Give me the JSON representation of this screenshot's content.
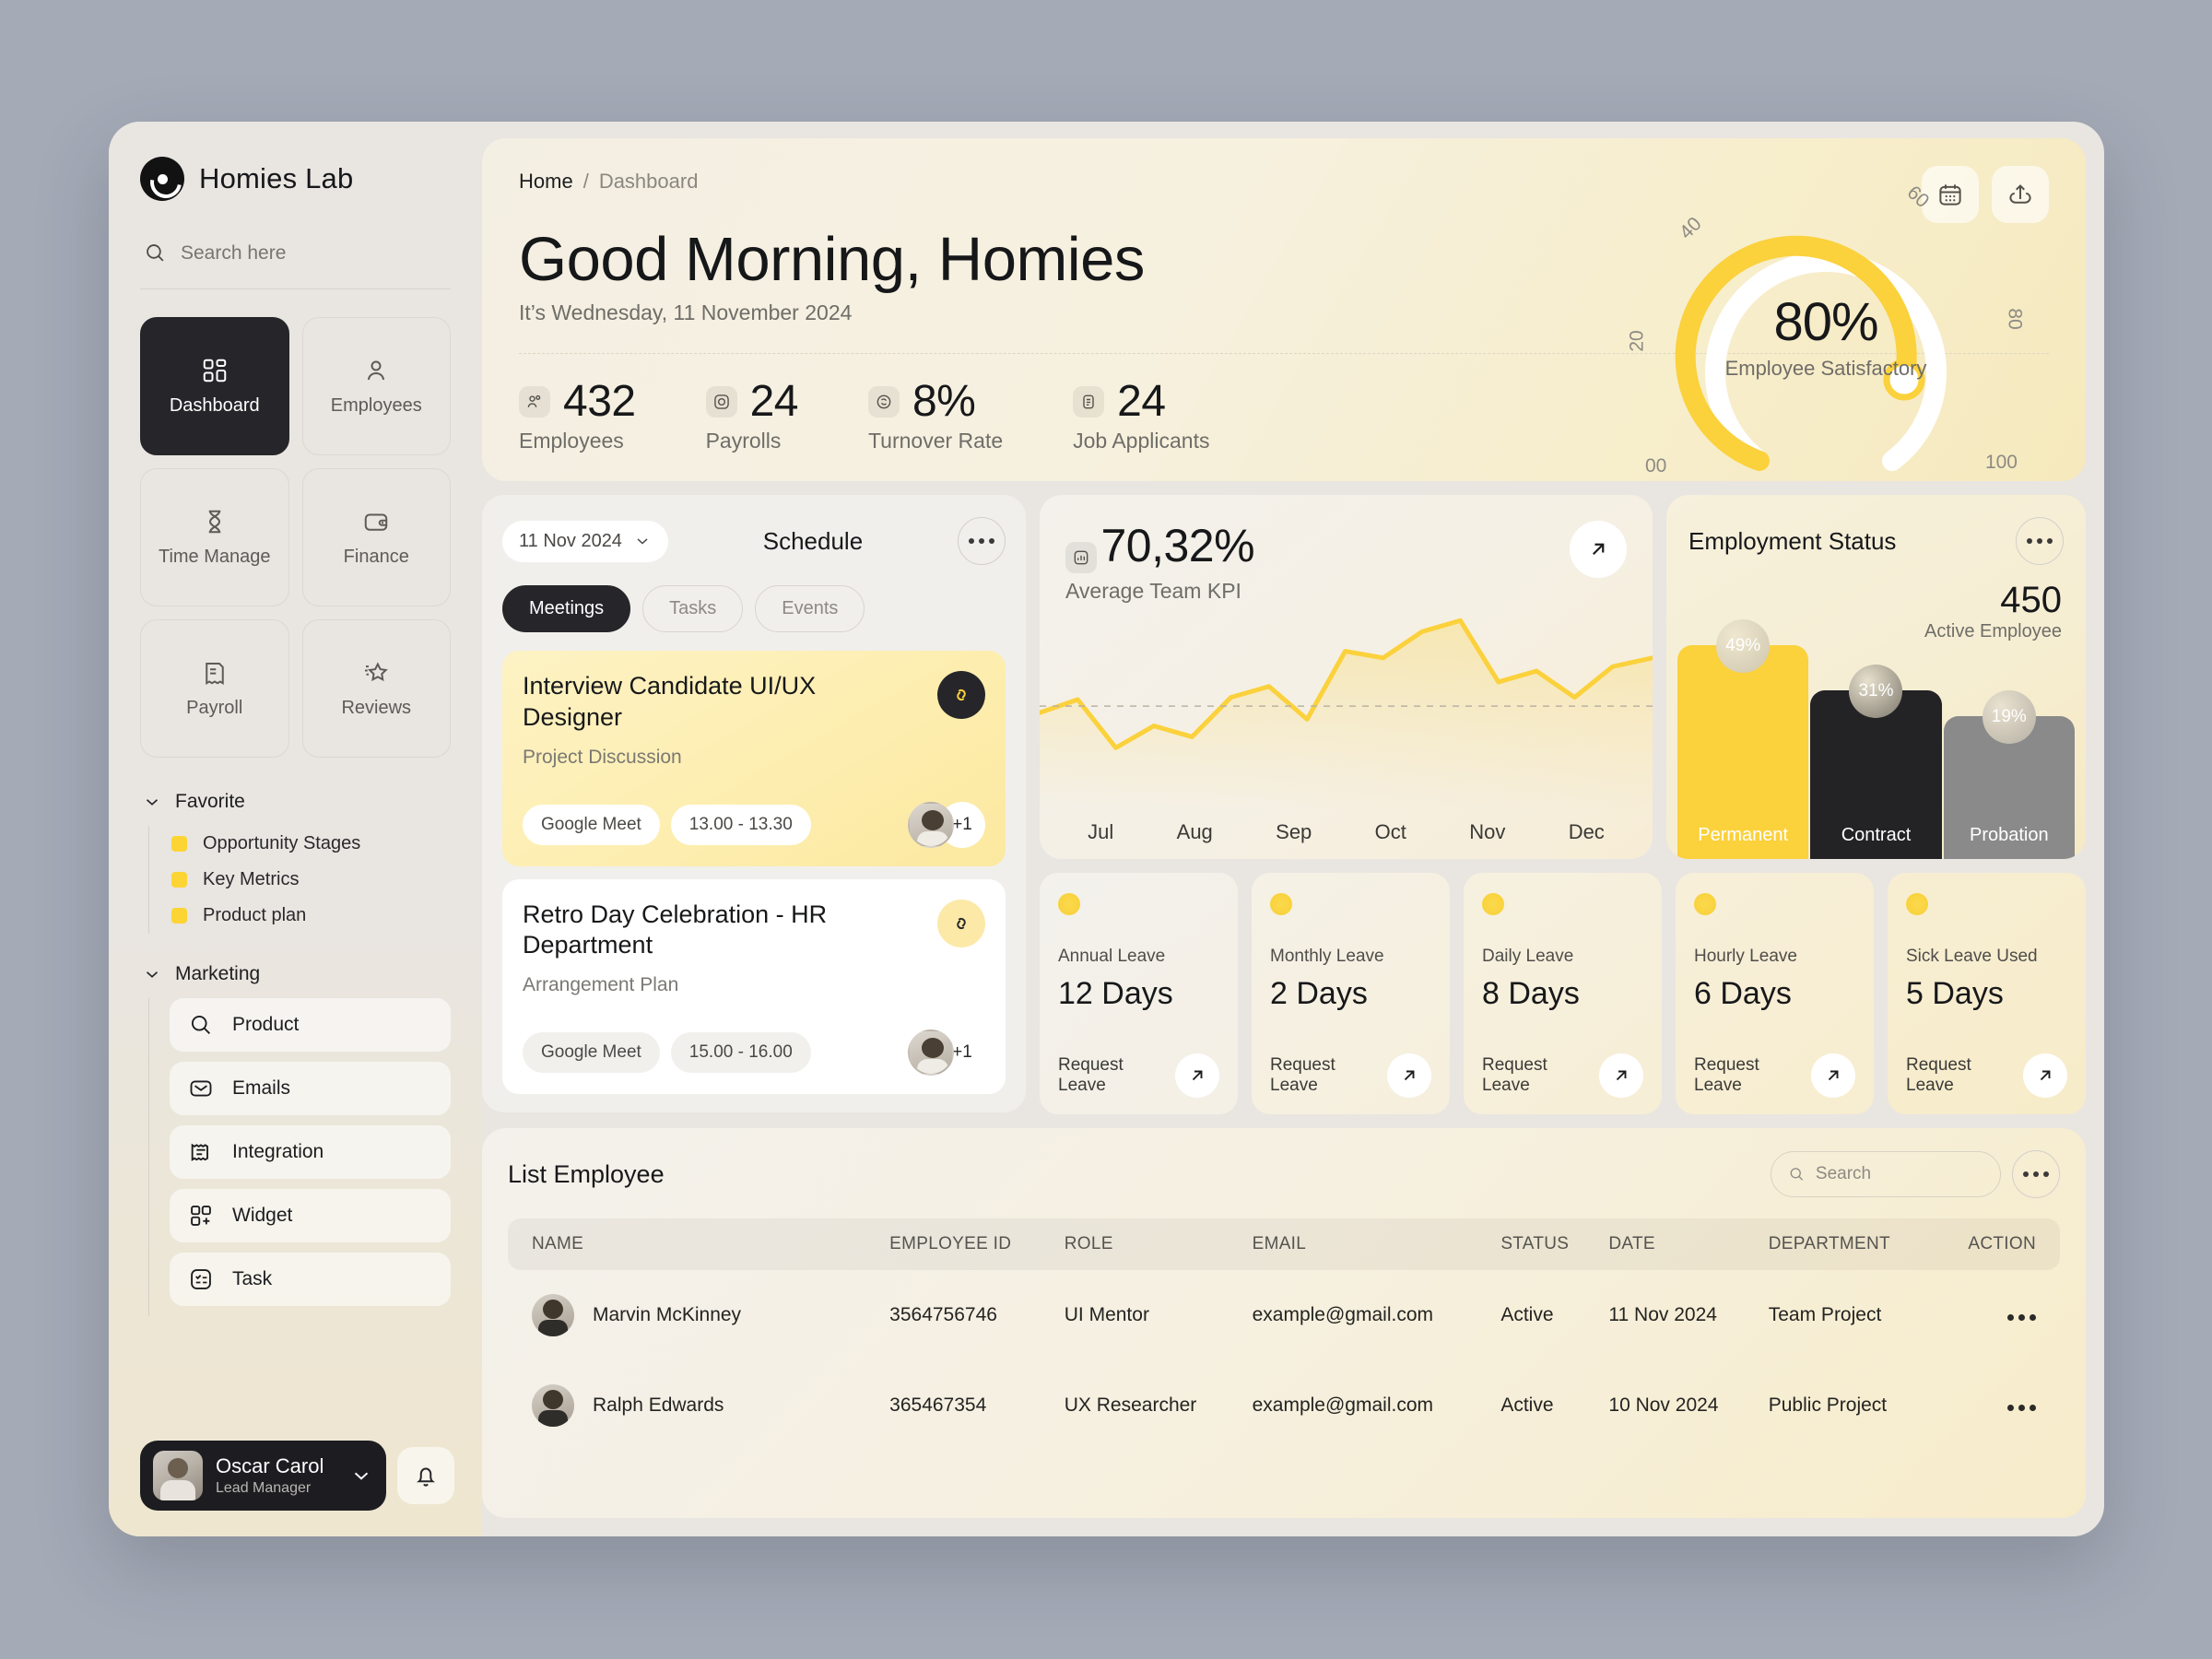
{
  "brand": {
    "name": "Homies Lab",
    "logo_icon": "logo-circle-icon"
  },
  "sidebar": {
    "search": {
      "placeholder": "Search here",
      "value": ""
    },
    "nav_tiles": [
      {
        "label": "Dashboard",
        "icon": "grid-icon",
        "active": true
      },
      {
        "label": "Employees",
        "icon": "user-icon",
        "active": false
      },
      {
        "label": "Time Manage",
        "icon": "hourglass-icon",
        "active": false
      },
      {
        "label": "Finance",
        "icon": "wallet-icon",
        "active": false
      },
      {
        "label": "Payroll",
        "icon": "receipt-icon",
        "active": false
      },
      {
        "label": "Reviews",
        "icon": "star-icon",
        "active": false
      }
    ],
    "favorite": {
      "title": "Favorite",
      "items": [
        {
          "label": "Opportunity Stages"
        },
        {
          "label": "Key Metrics"
        },
        {
          "label": "Product plan"
        }
      ]
    },
    "marketing": {
      "title": "Marketing",
      "items": [
        {
          "label": "Product",
          "icon": "search-icon"
        },
        {
          "label": "Emails",
          "icon": "envelope-icon"
        },
        {
          "label": "Integration",
          "icon": "integration-icon"
        },
        {
          "label": "Widget",
          "icon": "widget-icon"
        },
        {
          "label": "Task",
          "icon": "task-list-icon"
        }
      ]
    },
    "profile": {
      "name": "Oscar Carol",
      "role": "Lead Manager"
    }
  },
  "header": {
    "breadcrumb": {
      "home": "Home",
      "separator": "/",
      "current": "Dashboard"
    },
    "greeting": "Good Morning, Homies",
    "subtitle": "It’s Wednesday, 11 November 2024",
    "actions": [
      {
        "name": "calendar-button",
        "icon": "calendar-icon"
      },
      {
        "name": "share-button",
        "icon": "share-upload-icon"
      }
    ],
    "stats": [
      {
        "value": "432",
        "label": "Employees",
        "icon": "people-icon"
      },
      {
        "value": "24",
        "label": "Payrolls",
        "icon": "camera-icon"
      },
      {
        "value": "8%",
        "label": "Turnover Rate",
        "icon": "refresh-icon"
      },
      {
        "value": "24",
        "label": "Job Applicants",
        "icon": "document-icon"
      }
    ]
  },
  "gauge": {
    "value": "80%",
    "label": "Employee Satisfactory",
    "ticks": [
      "00",
      "20",
      "40",
      "60",
      "80",
      "100"
    ],
    "accent": "#FBD13C",
    "track": "#FFFFFF"
  },
  "schedule": {
    "date_pill": "11 Nov 2024",
    "title": "Schedule",
    "more_label": "more-options",
    "tabs": [
      {
        "label": "Meetings",
        "active": true
      },
      {
        "label": "Tasks",
        "active": false
      },
      {
        "label": "Events",
        "active": false
      }
    ],
    "events": [
      {
        "title": "Interview Candidate UI/UX Designer",
        "subtitle": "Project Discussion",
        "platform": "Google Meet",
        "time": "13.00 - 13.30",
        "attendees_more": "+1",
        "highlighted": true
      },
      {
        "title": "Retro Day Celebration - HR Department",
        "subtitle": "Arrangement Plan",
        "platform": "Google Meet",
        "time": "15.00 - 16.00",
        "attendees_more": "+1",
        "highlighted": false
      }
    ]
  },
  "employment": {
    "title": "Employment Status",
    "active_count": "450",
    "active_label": "Active Employee"
  },
  "leaves": [
    {
      "label": "Annual Leave",
      "value": "12 Days",
      "action": "Request Leave"
    },
    {
      "label": "Monthly Leave",
      "value": "2 Days",
      "action": "Request Leave"
    },
    {
      "label": "Daily Leave",
      "value": "8 Days",
      "action": "Request Leave"
    },
    {
      "label": "Hourly Leave",
      "value": "6 Days",
      "action": "Request Leave"
    },
    {
      "label": "Sick Leave Used",
      "value": "5 Days",
      "action": "Request Leave"
    }
  ],
  "employee_list": {
    "title": "List Employee",
    "search_placeholder": "Search",
    "search_value": "",
    "columns": [
      "NAME",
      "EMPLOYEE ID",
      "ROLE",
      "EMAIL",
      "STATUS",
      "DATE",
      "DEPARTMENT",
      "ACTION"
    ],
    "rows": [
      {
        "name": "Marvin McKinney",
        "employee_id": "3564756746",
        "role": "UI Mentor",
        "email": "example@gmail.com",
        "status": "Active",
        "date": "11 Nov 2024",
        "department": "Team Project"
      },
      {
        "name": "Ralph Edwards",
        "employee_id": "365467354",
        "role": "UX Researcher",
        "email": "example@gmail.com",
        "status": "Active",
        "date": "10 Nov 2024",
        "department": "Public Project"
      }
    ]
  },
  "chart_data": [
    {
      "type": "line",
      "title": "Average Team KPI",
      "headline_value": "70,32%",
      "x": [
        "Jul",
        "Aug",
        "Sep",
        "Oct",
        "Nov",
        "Dec"
      ],
      "xlabel": "",
      "ylabel": "",
      "categories": [
        "Jul",
        "Aug",
        "Sep",
        "Oct",
        "Nov",
        "Dec"
      ],
      "values": [
        44,
        50,
        28,
        38,
        33,
        51,
        56,
        40,
        69,
        66,
        78,
        83,
        58,
        63,
        50,
        62,
        66
      ],
      "ylim": [
        0,
        100
      ],
      "reference_line": 48,
      "grid": false,
      "legend": "none",
      "color": "#FBD13C"
    },
    {
      "type": "bar",
      "title": "Employment Status",
      "categories": [
        "Permanent",
        "Contract",
        "Probation"
      ],
      "values": [
        49,
        31,
        19
      ],
      "value_labels": [
        "49%",
        "31%",
        "19%"
      ],
      "colors": [
        "#FBD13C",
        "#232326",
        "#8A8A8A"
      ],
      "total": 450,
      "total_label": "Active Employee",
      "ylim": [
        0,
        55
      ],
      "grid": false,
      "legend": "none"
    },
    {
      "type": "gauge",
      "title": "Employee Satisfactory",
      "value": 80,
      "unit": "%",
      "min": 0,
      "max": 100,
      "ticks": [
        0,
        20,
        40,
        60,
        80,
        100
      ],
      "tick_labels": [
        "00",
        "20",
        "40",
        "60",
        "80",
        "100"
      ],
      "color": "#FBD13C",
      "track_color": "#FFFFFF"
    }
  ]
}
